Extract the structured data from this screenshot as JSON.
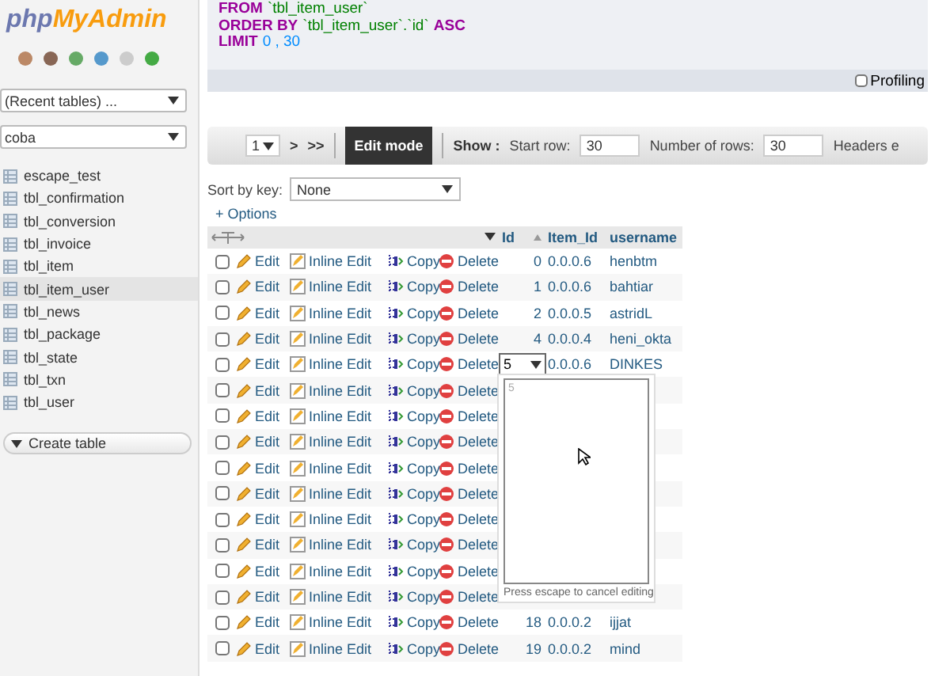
{
  "sidebar": {
    "logo": {
      "php": "php",
      "brand": "MyAdmin"
    },
    "recent_select": {
      "value": "(Recent tables) ..."
    },
    "database_select": {
      "value": "coba"
    },
    "tables": [
      {
        "label": "escape_test",
        "selected": false
      },
      {
        "label": "tbl_confirmation",
        "selected": false
      },
      {
        "label": "tbl_conversion",
        "selected": false
      },
      {
        "label": "tbl_invoice",
        "selected": false
      },
      {
        "label": "tbl_item",
        "selected": false
      },
      {
        "label": "tbl_item_user",
        "selected": true
      },
      {
        "label": "tbl_news",
        "selected": false
      },
      {
        "label": "tbl_package",
        "selected": false
      },
      {
        "label": "tbl_state",
        "selected": false
      },
      {
        "label": "tbl_txn",
        "selected": false
      },
      {
        "label": "tbl_user",
        "selected": false
      }
    ],
    "create_table": "Create table"
  },
  "sql": {
    "lines": [
      [
        {
          "kind": "keyword",
          "text": "FROM"
        },
        {
          "kind": "identifier",
          "text": "`tbl_item_user`"
        }
      ],
      [
        {
          "kind": "keyword",
          "text": "ORDER BY"
        },
        {
          "kind": "identifier",
          "text": "`tbl_item_user`.`id`"
        },
        {
          "kind": "keyword",
          "text": "ASC"
        }
      ],
      [
        {
          "kind": "keyword",
          "text": "LIMIT"
        },
        {
          "kind": "number",
          "text": "0 , 30"
        }
      ]
    ],
    "profiling": {
      "label": "Profiling",
      "checked": false
    }
  },
  "toolbar": {
    "page": "1",
    "next": ">",
    "last": ">>",
    "edit_mode": "Edit mode",
    "show": "Show :",
    "start_label": "Start row:",
    "start_value": "30",
    "rows_label": "Number of rows:",
    "rows_value": "30",
    "headers": "Headers e"
  },
  "sort": {
    "label": "Sort by key:",
    "value": "None"
  },
  "options": "+ Options",
  "columns": [
    "Id",
    "Item_Id",
    "username"
  ],
  "rows": [
    {
      "checked": false,
      "actions": [
        "Edit",
        "Inline Edit",
        "Copy",
        "Delete"
      ],
      "id": "0",
      "item_id": "0.0.0.6",
      "username": "henbtm"
    },
    {
      "checked": false,
      "actions": [
        "Edit",
        "Inline Edit",
        "Copy",
        "Delete"
      ],
      "id": "1",
      "item_id": "0.0.0.6",
      "username": "bahtiar"
    },
    {
      "checked": false,
      "actions": [
        "Edit",
        "Inline Edit",
        "Copy",
        "Delete"
      ],
      "id": "2",
      "item_id": "0.0.0.5",
      "username": "astridL"
    },
    {
      "checked": false,
      "actions": [
        "Edit",
        "Inline Edit",
        "Copy",
        "Delete"
      ],
      "id": "4",
      "item_id": "0.0.0.4",
      "username": "heni_okta"
    },
    {
      "checked": false,
      "actions": [
        "Edit",
        "Inline Edit",
        "Copy",
        "Delete"
      ],
      "editing": true,
      "id": "5",
      "item_id": "0.0.0.6",
      "username": "DINKES"
    },
    {
      "checked": false,
      "actions": [
        "Edit",
        "Inline Edit",
        "Copy",
        "Delete"
      ]
    },
    {
      "checked": false,
      "actions": [
        "Edit",
        "Inline Edit",
        "Copy",
        "Delete"
      ]
    },
    {
      "checked": false,
      "actions": [
        "Edit",
        "Inline Edit",
        "Copy",
        "Delete"
      ]
    },
    {
      "checked": false,
      "actions": [
        "Edit",
        "Inline Edit",
        "Copy",
        "Delete"
      ]
    },
    {
      "checked": false,
      "actions": [
        "Edit",
        "Inline Edit",
        "Copy",
        "Delete"
      ]
    },
    {
      "checked": false,
      "actions": [
        "Edit",
        "Inline Edit",
        "Copy",
        "Delete"
      ]
    },
    {
      "checked": false,
      "actions": [
        "Edit",
        "Inline Edit",
        "Copy",
        "Delete"
      ]
    },
    {
      "checked": false,
      "actions": [
        "Edit",
        "Inline Edit",
        "Copy",
        "Delete"
      ]
    },
    {
      "checked": false,
      "actions": [
        "Edit",
        "Inline Edit",
        "Copy",
        "Delete"
      ]
    },
    {
      "checked": false,
      "actions": [
        "Edit",
        "Inline Edit",
        "Copy",
        "Delete"
      ],
      "id": "18",
      "item_id": "0.0.0.2",
      "username": "ijjat"
    },
    {
      "checked": false,
      "actions": [
        "Edit",
        "Inline Edit",
        "Copy",
        "Delete"
      ],
      "id": "19",
      "item_id": "0.0.0.2",
      "username": "mind"
    }
  ],
  "editor": {
    "value": "5",
    "hint": "Press escape to cancel editing"
  }
}
